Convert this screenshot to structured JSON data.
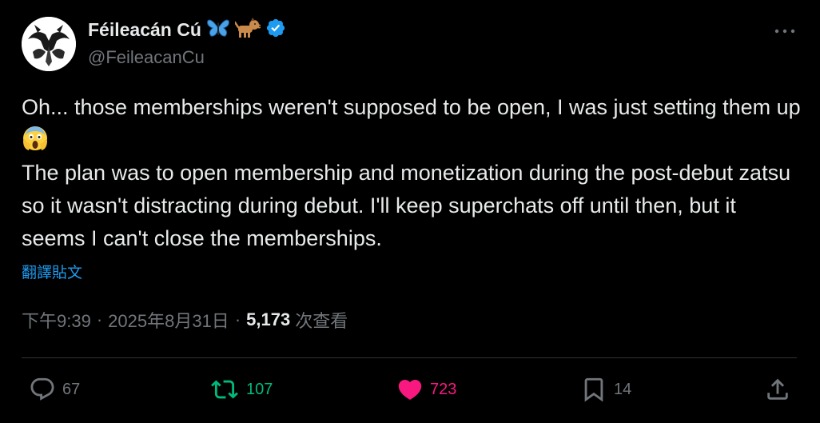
{
  "author": {
    "display_name": "Féileacán Cú",
    "name_emojis": [
      "butterfly-emoji",
      "dog-emoji"
    ],
    "handle": "@FeileacanCu",
    "verified": true
  },
  "tweet": {
    "line1": "Oh... those memberships weren't supposed to be open, I was just setting them up",
    "emoji": "face-screaming-in-fear",
    "line2": "The plan was to open membership and monetization during the post-debut zatsu so it wasn't distracting during debut. I'll keep superchats off until then, but it seems I can't close the memberships.",
    "translate_label": "翻譯貼文"
  },
  "meta": {
    "time": "下午9:39",
    "date": "2025年8月31日",
    "separator": "·",
    "views_count": "5,173",
    "views_label": "次查看"
  },
  "actions": {
    "replies": "67",
    "reposts": "107",
    "likes": "723",
    "bookmarks": "14"
  },
  "colors": {
    "background": "#000000",
    "text": "#e7e9ea",
    "secondary": "#71767b",
    "link": "#1d9bf0",
    "repost": "#00ba7c",
    "like": "#f91880",
    "verified": "#1d9bf0"
  }
}
